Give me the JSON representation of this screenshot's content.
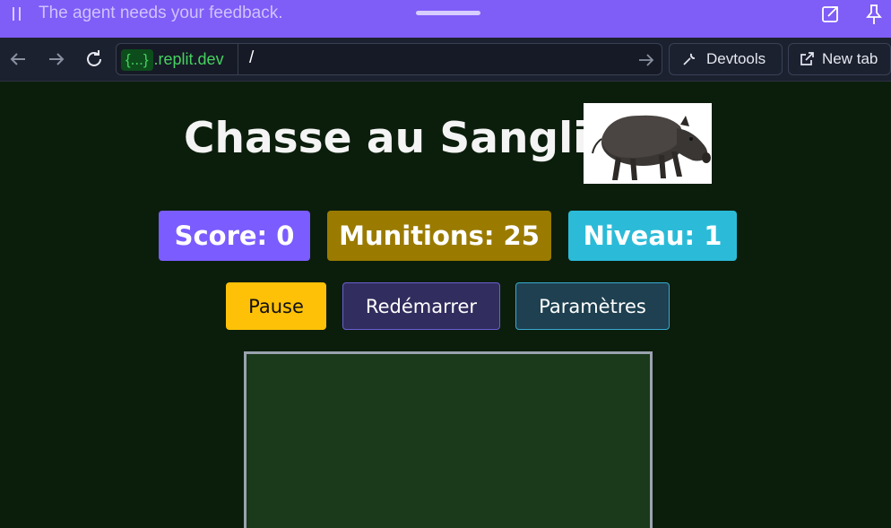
{
  "agent_banner": {
    "message": "The agent needs your feedback.",
    "pause_icon": "pause-icon",
    "expand_icon": "expand-icon",
    "pin_icon": "pin-icon",
    "background": "#7f5df7"
  },
  "browser": {
    "url_host_badge": "{...}",
    "url_host": ".replit.dev",
    "url_path": "/",
    "devtools_label": "Devtools",
    "new_tab_label": "New tab"
  },
  "game": {
    "title": "Chasse au Sanglier",
    "image_alt": "wild boar",
    "stats": {
      "score_label": "Score: 0",
      "ammo_label": "Munitions: 25",
      "level_label": "Niveau: 1"
    },
    "buttons": {
      "pause": "Pause",
      "restart": "Redémarrer",
      "settings": "Paramètres"
    },
    "colors": {
      "score": "#7b5cff",
      "ammo": "#9a7b00",
      "level": "#2bbbd8",
      "pause_button": "#ffc107",
      "restart_button": "#312d5e",
      "settings_button": "#1e4050",
      "game_area": "#1b391b"
    }
  }
}
